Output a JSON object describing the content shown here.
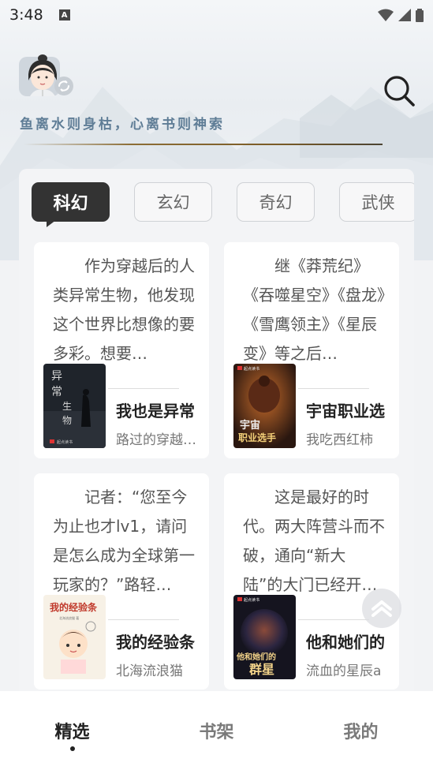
{
  "status_bar": {
    "time": "3:48",
    "notification_letter": "A"
  },
  "header": {
    "slogan": "鱼离水则身枯，心离书则神索"
  },
  "tabs": [
    {
      "label": "科幻",
      "active": true
    },
    {
      "label": "玄幻",
      "active": false
    },
    {
      "label": "奇幻",
      "active": false
    },
    {
      "label": "武侠",
      "active": false
    }
  ],
  "books": [
    {
      "description": "作为穿越后的人类异常生物，他发现这个世界比想像的要多彩。想要…",
      "title": "我也是异常",
      "author": "路过的穿越…",
      "cover_text": "异常生物",
      "cover_color": "#20252c"
    },
    {
      "description": "继《莽荒纪》《吞噬星空》《盘龙》《雪鹰领主》《星辰变》等之后…",
      "title": "宇宙职业选",
      "author": "我吃西红柿",
      "cover_text": "宇宙职业选手",
      "cover_color": "#3a2418"
    },
    {
      "description": "记者：“您至今为止也才lv1，请问是怎么成为全球第一玩家的？”路轻…",
      "title": "我的经验条",
      "author": "北海流浪猫",
      "cover_text": "我的经验条",
      "cover_color": "#f4efe6"
    },
    {
      "description": "这是最好的时代。两大阵营斗而不破，通向“新大陆”的大门已经开…",
      "title": "他和她们的",
      "author": "流血的星辰a",
      "cover_text": "他和她们的群星",
      "cover_color": "#1e2130"
    }
  ],
  "bottom_nav": [
    {
      "label": "精选",
      "active": true
    },
    {
      "label": "书架",
      "active": false
    },
    {
      "label": "我的",
      "active": false
    }
  ]
}
